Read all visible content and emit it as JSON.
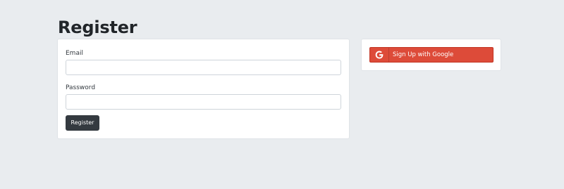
{
  "page": {
    "title": "Register"
  },
  "register_form": {
    "email_label": "Email",
    "email_value": "",
    "email_placeholder": "",
    "password_label": "Password",
    "password_value": "",
    "password_placeholder": "",
    "submit_label": "Register"
  },
  "social": {
    "google_label": "Sign Up with Google",
    "google_icon": "google-g-icon"
  },
  "colors": {
    "background": "#e9ecef",
    "card": "#ffffff",
    "primary_button": "#343a40",
    "google_red": "#dd4b39"
  }
}
